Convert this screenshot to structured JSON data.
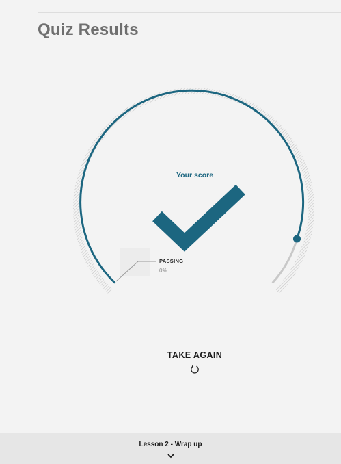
{
  "page": {
    "title": "Quiz Results"
  },
  "score": {
    "label": "Your score",
    "percent": 100,
    "status_icon": "checkmark-icon",
    "accent_color": "#1c6680"
  },
  "passing": {
    "label": "PASSING",
    "value": "0%",
    "percent": 0
  },
  "actions": {
    "take_again_label": "TAKE AGAIN",
    "take_again_icon": "retry-icon"
  },
  "footer": {
    "next_lesson_label": "Lesson 2 - Wrap up",
    "next_icon": "chevron-down-icon"
  },
  "colors": {
    "background": "#f3f3f3",
    "accent": "#1c6680",
    "track": "#c8c8c8",
    "title": "#6f6f6f"
  }
}
